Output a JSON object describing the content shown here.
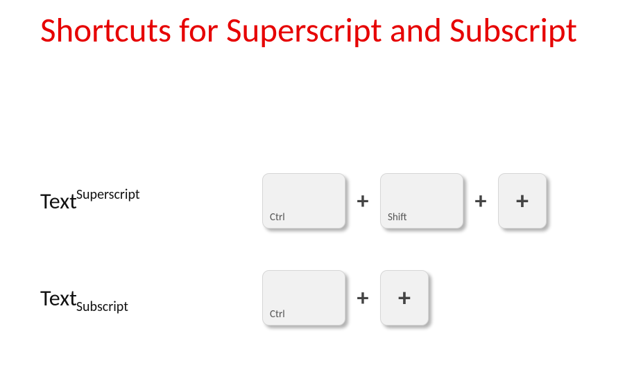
{
  "title": "Shortcuts for Superscript and Subscript",
  "rows": {
    "superscript": {
      "example": {
        "base": "Text",
        "script": "Superscript"
      },
      "keys": [
        "Ctrl",
        "Shift",
        "+"
      ],
      "sep": "+"
    },
    "subscript": {
      "example": {
        "base": "Text",
        "script": "Subscript"
      },
      "keys": [
        "Ctrl",
        "+"
      ],
      "sep": "+"
    }
  }
}
